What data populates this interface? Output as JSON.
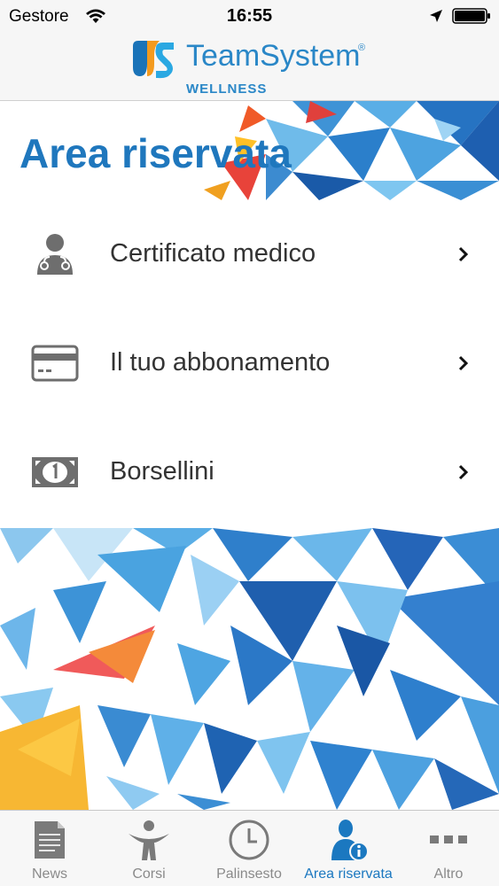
{
  "status_bar": {
    "carrier": "Gestore",
    "time": "16:55",
    "icons": [
      "wifi-icon",
      "location-arrow-icon",
      "battery-icon"
    ]
  },
  "header": {
    "brand": "TeamSystem",
    "registered": "®",
    "subtitle": "WELLNESS"
  },
  "banner": {
    "title": "Area riservata"
  },
  "menu": {
    "items": [
      {
        "label": "Certificato medico",
        "icon": "doctor-icon"
      },
      {
        "label": "Il tuo abbonamento",
        "icon": "credit-card-icon"
      },
      {
        "label": "Borsellini",
        "icon": "banknote-icon"
      }
    ]
  },
  "tabbar": {
    "tabs": [
      {
        "label": "News",
        "icon": "newspaper-icon"
      },
      {
        "label": "Corsi",
        "icon": "person-fitness-icon"
      },
      {
        "label": "Palinsesto",
        "icon": "clock-icon"
      },
      {
        "label": "Area riservata",
        "icon": "user-info-icon",
        "active": true
      },
      {
        "label": "Altro",
        "icon": "more-dots-icon"
      }
    ]
  },
  "colors": {
    "brand_blue": "#2a87c7",
    "title_blue": "#1f77bd",
    "active_tab": "#1b78c0",
    "inactive_tab": "#8a8a8a",
    "menu_text": "#333333"
  }
}
